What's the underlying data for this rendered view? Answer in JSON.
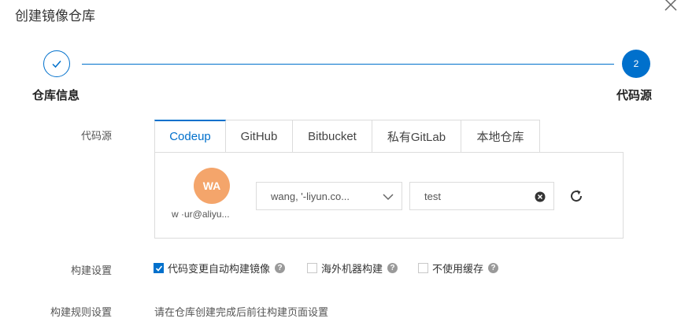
{
  "dialog": {
    "title": "创建镜像仓库",
    "close_icon": "close-icon"
  },
  "steps": [
    {
      "label": "仓库信息",
      "state": "done",
      "icon": "check-icon"
    },
    {
      "label": "代码源",
      "state": "active",
      "number": "2"
    }
  ],
  "form": {
    "code_source_label": "代码源",
    "tabs": [
      {
        "label": "Codeup",
        "active": true
      },
      {
        "label": "GitHub",
        "active": false
      },
      {
        "label": "Bitbucket",
        "active": false
      },
      {
        "label": "私有GitLab",
        "active": false
      },
      {
        "label": "本地仓库",
        "active": false
      }
    ],
    "account": {
      "avatar_initials": "WA",
      "name": "w      ·ur@aliyu..."
    },
    "org_select": {
      "value": "wang,  '-liyun.co...",
      "icon": "chevron-down-icon"
    },
    "repo_input": {
      "value": "test",
      "icon": "clear-icon"
    },
    "refresh_icon": "refresh-icon",
    "build_settings_label": "构建设置",
    "build_options": [
      {
        "label": "代码变更自动构建镜像",
        "checked": true
      },
      {
        "label": "海外机器构建",
        "checked": false
      },
      {
        "label": "不使用缓存",
        "checked": false
      }
    ],
    "build_rules_label": "构建规则设置",
    "build_rules_text": "请在仓库创建完成后前往构建页面设置"
  },
  "colors": {
    "accent": "#0070cc",
    "avatar": "#f4a56b",
    "border": "#dcdcdc"
  }
}
